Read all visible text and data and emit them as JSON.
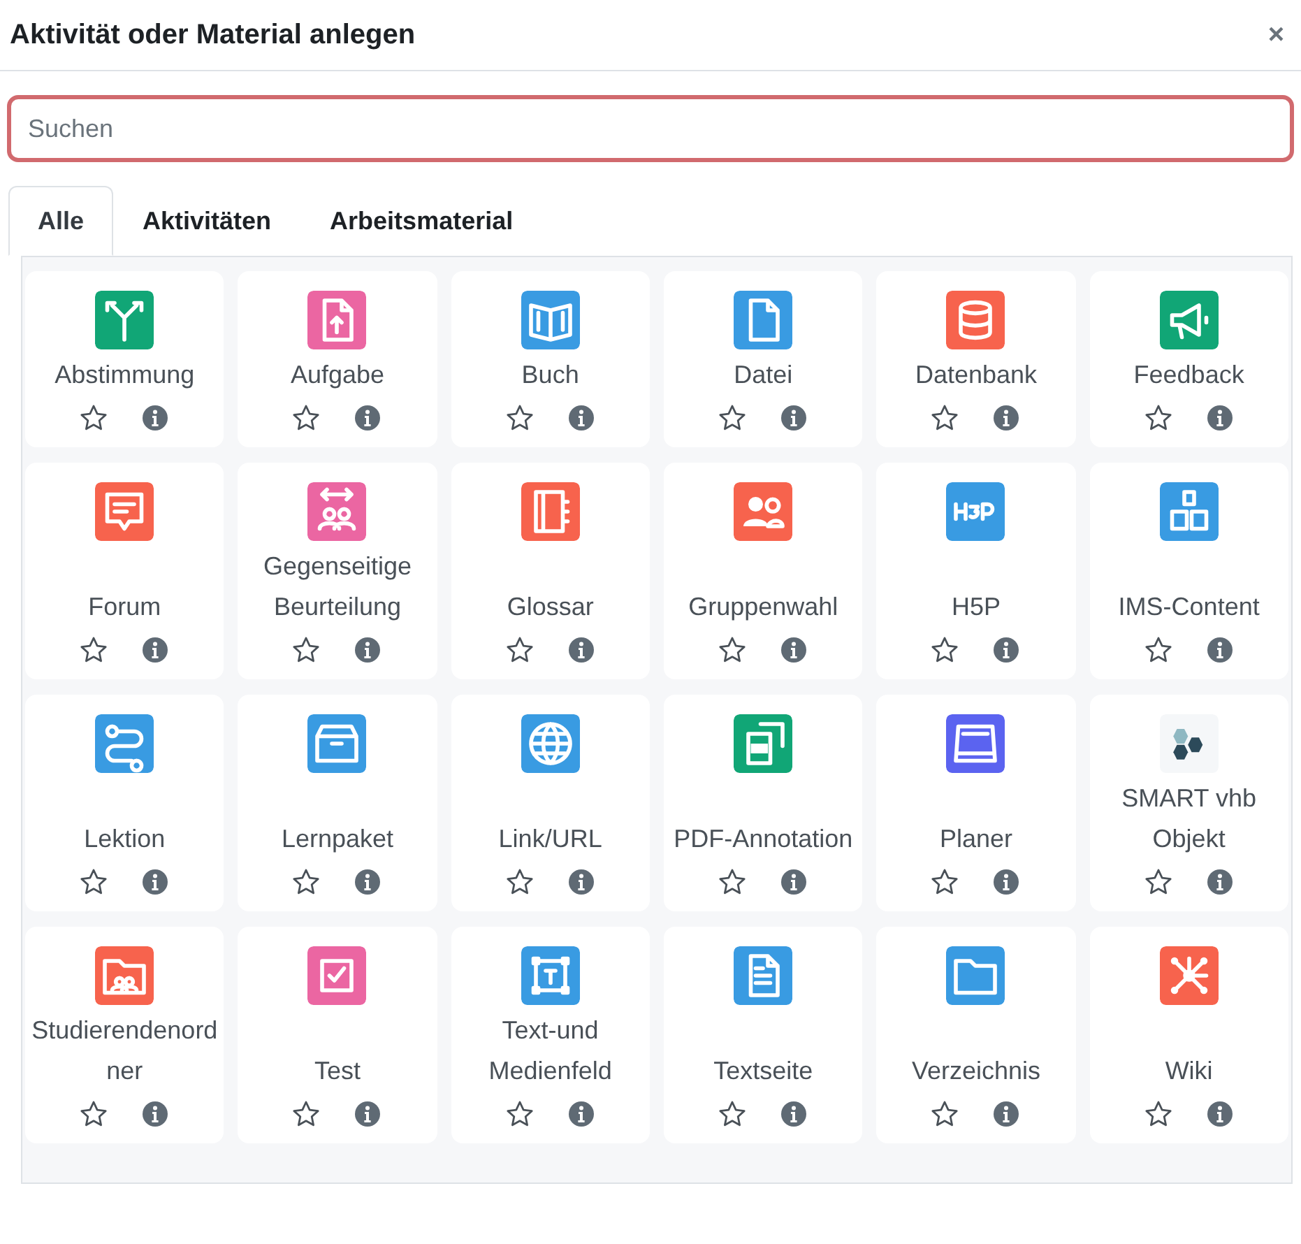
{
  "dialog": {
    "title": "Aktivität oder Material anlegen",
    "close": "×"
  },
  "search": {
    "placeholder": "Suchen",
    "focused": true
  },
  "tabs": [
    {
      "label": "Alle",
      "selected": true
    },
    {
      "label": "Aktivitäten",
      "selected": false
    },
    {
      "label": "Arbeitsmaterial",
      "selected": false
    }
  ],
  "items": [
    {
      "label": "Abstimmung",
      "color": "#11a676",
      "favourite": false
    },
    {
      "label": "Aufgabe",
      "color": "#eb66a2",
      "favourite": false
    },
    {
      "label": "Buch",
      "color": "#399be2",
      "favourite": false
    },
    {
      "label": "Datei",
      "color": "#399be2",
      "favourite": false
    },
    {
      "label": "Datenbank",
      "color": "#f7634d",
      "favourite": false
    },
    {
      "label": "Feedback",
      "color": "#11a676",
      "favourite": false
    },
    {
      "label": "Forum",
      "color": "#f7634d",
      "favourite": false
    },
    {
      "label": "Gegenseitige Beurteilung",
      "color": "#eb66a2",
      "favourite": false
    },
    {
      "label": "Glossar",
      "color": "#f7634d",
      "favourite": false
    },
    {
      "label": "Gruppenwahl",
      "color": "#f7634d",
      "favourite": false
    },
    {
      "label": "H5P",
      "color": "#399be2",
      "favourite": false
    },
    {
      "label": "IMS-Content",
      "color": "#399be2",
      "favourite": false
    },
    {
      "label": "Lektion",
      "color": "#399be2",
      "favourite": false
    },
    {
      "label": "Lernpaket",
      "color": "#399be2",
      "favourite": false
    },
    {
      "label": "Link/URL",
      "color": "#399be2",
      "favourite": false
    },
    {
      "label": "PDF-Annotation",
      "color": "#11a676",
      "favourite": false
    },
    {
      "label": "Planer",
      "color": "#5b63f0",
      "favourite": false
    },
    {
      "label": "SMART vhb Objekt",
      "color": "#f5f7f9",
      "favourite": false
    },
    {
      "label": "Studierendenordner",
      "color": "#f7634d",
      "favourite": false
    },
    {
      "label": "Test",
      "color": "#eb66a2",
      "favourite": false
    },
    {
      "label": "Text-und Medienfeld",
      "color": "#399be2",
      "favourite": false
    },
    {
      "label": "Textseite",
      "color": "#399be2",
      "favourite": false
    },
    {
      "label": "Verzeichnis",
      "color": "#399be2",
      "favourite": false
    },
    {
      "label": "Wiki",
      "color": "#f7634d",
      "favourite": false
    }
  ]
}
